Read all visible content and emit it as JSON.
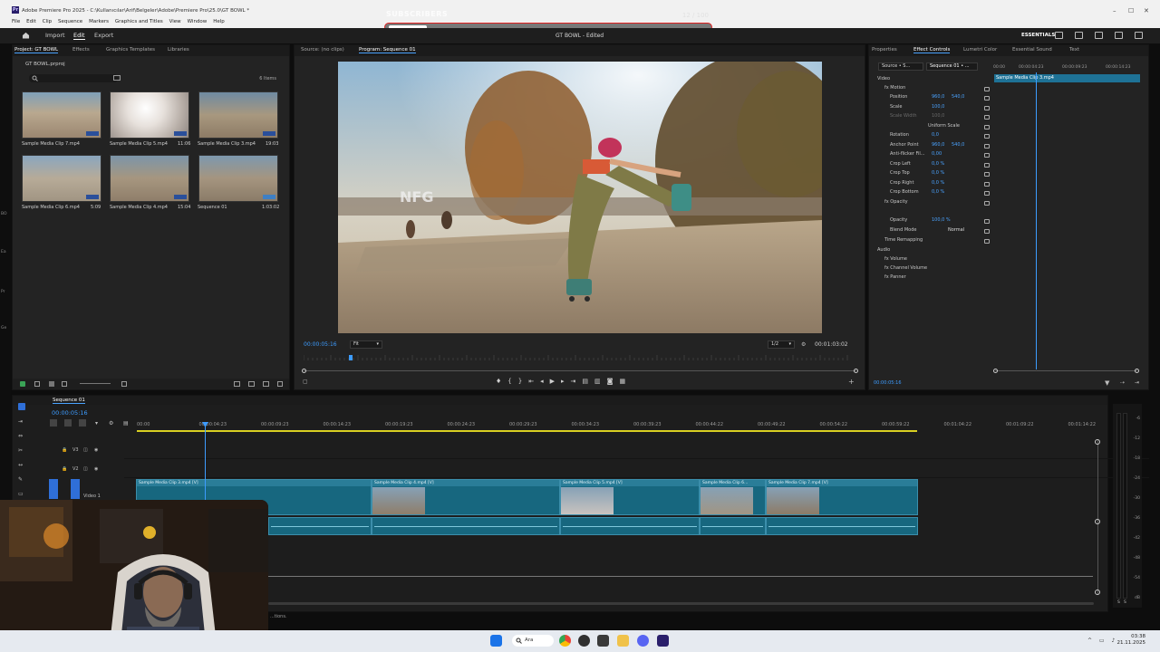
{
  "window": {
    "title": "Adobe Premiere Pro 2025 - C:\\Kullanıcılar\\Arif\\Belgeler\\Adobe\\Premiere Pro\\25.0\\GT BOWL *",
    "controls": [
      "–",
      "☐",
      "✕"
    ]
  },
  "menu": [
    "File",
    "Edit",
    "Clip",
    "Sequence",
    "Markers",
    "Graphics and Titles",
    "View",
    "Window",
    "Help"
  ],
  "overlay": {
    "label": "SUBSCRIBERS",
    "count": "12 / 100",
    "progress": 0.12,
    "accent": "#e02020"
  },
  "workspace": {
    "tabs": [
      "Import",
      "Edit",
      "Export"
    ],
    "active": "Edit",
    "project_title": "GT BOWL - Edited",
    "workspace_name": "ESSENTIALS"
  },
  "project": {
    "tabs": [
      "Project: GT BOWL",
      "Effects",
      "Graphics Templates",
      "Libraries"
    ],
    "file": "GT BOWL.prproj",
    "count": "6 Items",
    "items": [
      {
        "name": "Sample Media Clip 7.mp4",
        "duration": "",
        "palette": "#9a8670"
      },
      {
        "name": "Sample Media Clip 5.mp4",
        "duration": "11:06",
        "palette": "#c9c3bf"
      },
      {
        "name": "Sample Media Clip 3.mp4",
        "duration": "19:03",
        "palette": "#8d7b66"
      },
      {
        "name": "Sample Media Clip 6.mp4",
        "duration": "5:09",
        "palette": "#a19583"
      },
      {
        "name": "Sample Media Clip 4.mp4",
        "duration": "15:04",
        "palette": "#8f7e6a"
      },
      {
        "name": "Sequence 01",
        "duration": "1:03:02",
        "palette": "#8a7b68"
      }
    ]
  },
  "monitor": {
    "source_tab": "Source: (no clips)",
    "program_tab": "Program: Sequence 01",
    "timecode": "00:00:05:16",
    "fit": "Fit",
    "resolution": "1/2",
    "duration": "00:01:03:02",
    "overlay_text": "NFG"
  },
  "effects": {
    "tabs": [
      "Properties",
      "Effect Controls",
      "Lumetri Color",
      "Essential Sound",
      "Text"
    ],
    "source": "Source • S...",
    "sequence": "Sequence 01 • ...",
    "clip_label": "Sample Media Clip 3.mp4",
    "ruler": [
      "00:00",
      "00:00:04:23",
      "00:00:09:23",
      "00:00:14:23"
    ],
    "video_label": "Video",
    "audio_label": "Audio",
    "rows": [
      {
        "label": "fx  Motion",
        "v1": "",
        "v2": ""
      },
      {
        "label": "Position",
        "v1": "960,0",
        "v2": "540,0"
      },
      {
        "label": "Scale",
        "v1": "100,0",
        "v2": ""
      },
      {
        "label": "Scale Width",
        "v1": "100,0",
        "v2": ""
      },
      {
        "label": "Uniform Scale",
        "v1": "",
        "v2": ""
      },
      {
        "label": "Rotation",
        "v1": "0,0",
        "v2": ""
      },
      {
        "label": "Anchor Point",
        "v1": "960,0",
        "v2": "540,0"
      },
      {
        "label": "Anti-flicker Fil...",
        "v1": "0,00",
        "v2": ""
      },
      {
        "label": "Crop Left",
        "v1": "0,0 %",
        "v2": ""
      },
      {
        "label": "Crop Top",
        "v1": "0,0 %",
        "v2": ""
      },
      {
        "label": "Crop Right",
        "v1": "0,0 %",
        "v2": ""
      },
      {
        "label": "Crop Bottom",
        "v1": "0,0 %",
        "v2": ""
      },
      {
        "label": "fx  Opacity",
        "v1": "",
        "v2": ""
      },
      {
        "label": "Opacity",
        "v1": "100,0 %",
        "v2": ""
      },
      {
        "label": "Blend Mode",
        "v1": "Normal",
        "v2": ""
      },
      {
        "label": "Time Remapping",
        "v1": "",
        "v2": ""
      }
    ],
    "audio_rows": [
      "fx  Volume",
      "fx  Channel Volume",
      "fx  Panner"
    ],
    "timecode": "00:00:05:16"
  },
  "timeline": {
    "sequence_tab": "Sequence 01",
    "timecode": "00:00:05:16",
    "ruler": [
      "00:00",
      "00:00:04:23",
      "00:00:09:23",
      "00:00:14:23",
      "00:00:19:23",
      "00:00:24:23",
      "00:00:29:23",
      "00:00:34:23",
      "00:00:39:23",
      "00:00:44:22",
      "00:00:49:22",
      "00:00:54:22",
      "00:00:59:22",
      "00:01:04:22",
      "00:01:09:22",
      "00:01:14:22"
    ],
    "tracks": [
      {
        "id": "V3",
        "label": "V3"
      },
      {
        "id": "V2",
        "label": "V2"
      },
      {
        "id": "V1",
        "label": "Video 1"
      }
    ],
    "clips": [
      {
        "name": "Sample Media Clip 3.mp4 [V]"
      },
      {
        "name": "Sample Media Clip 4.mp4 [V]"
      },
      {
        "name": "Sample Media Clip 5.mp4 [V]"
      },
      {
        "name": "Sample Media Clip 6..."
      },
      {
        "name": "Sample Media Clip 7.mp4 [V]"
      }
    ],
    "status_fragment": "...tions.",
    "vu_scale": [
      "-6",
      "-12",
      "-18",
      "-24",
      "-30",
      "-36",
      "-42",
      "-48",
      "-54",
      "dB"
    ],
    "vu_footer": [
      "S",
      "S"
    ]
  },
  "sidebar_letters": [
    "BO",
    "Ea",
    "Pr",
    "Ge"
  ],
  "taskbar": {
    "search": "Ara",
    "time": "03:38",
    "date": "21.11.2025",
    "apps": [
      "start",
      "search",
      "chrome",
      "obs",
      "explorer",
      "discord",
      "premiere"
    ]
  }
}
